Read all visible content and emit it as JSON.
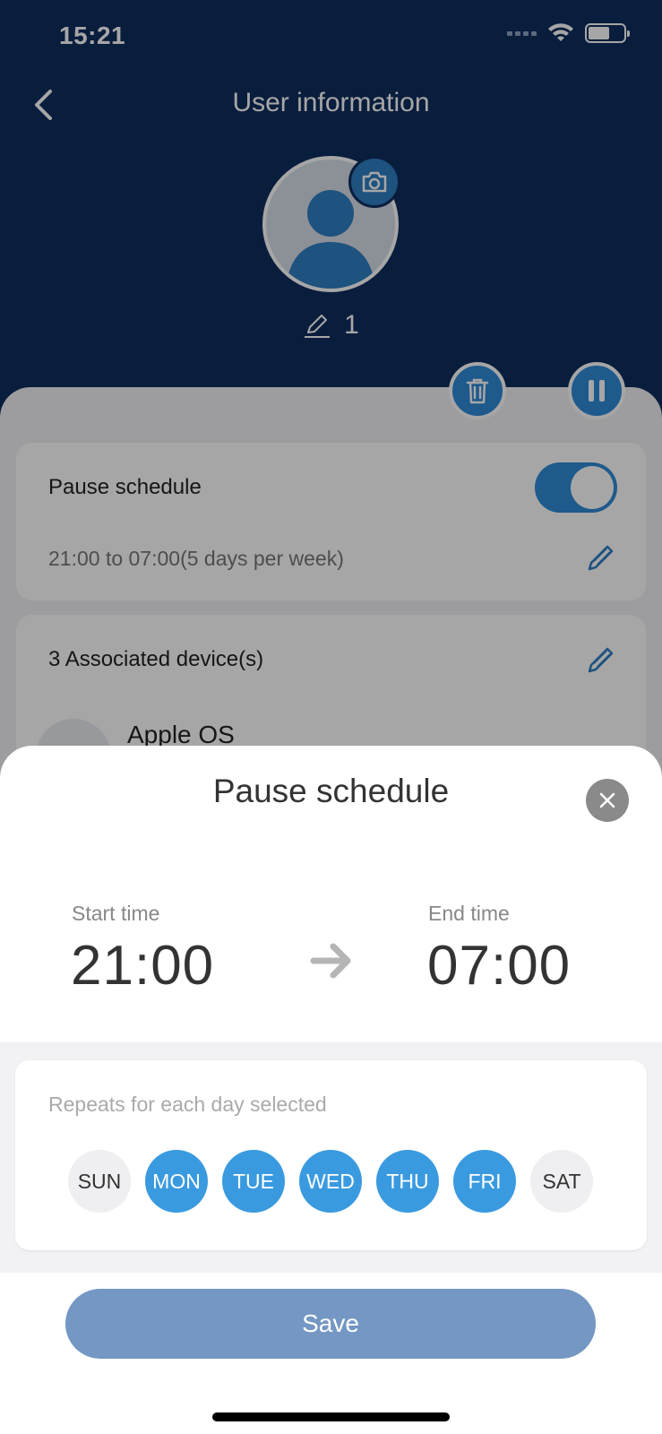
{
  "status_bar": {
    "time": "15:21",
    "icons": [
      "signal-icon",
      "wifi-icon",
      "battery-icon"
    ]
  },
  "header": {
    "title": "User information",
    "back_icon": "chevron-left-icon",
    "user_name": "1"
  },
  "actions": {
    "delete_icon": "trash-icon",
    "pause_icon": "pause-icon"
  },
  "pause_card": {
    "title": "Pause schedule",
    "toggle_on": true,
    "summary": "21:00 to 07:00(5 days per week)"
  },
  "devices_card": {
    "title": "3 Associated device(s)",
    "first_device": "Apple OS"
  },
  "sheet": {
    "title": "Pause schedule",
    "start_label": "Start time",
    "start_time": "21:00",
    "end_label": "End time",
    "end_time": "07:00",
    "repeat_hint": "Repeats for each day selected",
    "days": [
      {
        "label": "SUN",
        "selected": false
      },
      {
        "label": "MON",
        "selected": true
      },
      {
        "label": "TUE",
        "selected": true
      },
      {
        "label": "WED",
        "selected": true
      },
      {
        "label": "THU",
        "selected": true
      },
      {
        "label": "FRI",
        "selected": true
      },
      {
        "label": "SAT",
        "selected": false
      }
    ],
    "save_label": "Save"
  },
  "colors": {
    "header": "#0f2d5e",
    "accent": "#3a9ae0",
    "save": "#7497c3"
  }
}
